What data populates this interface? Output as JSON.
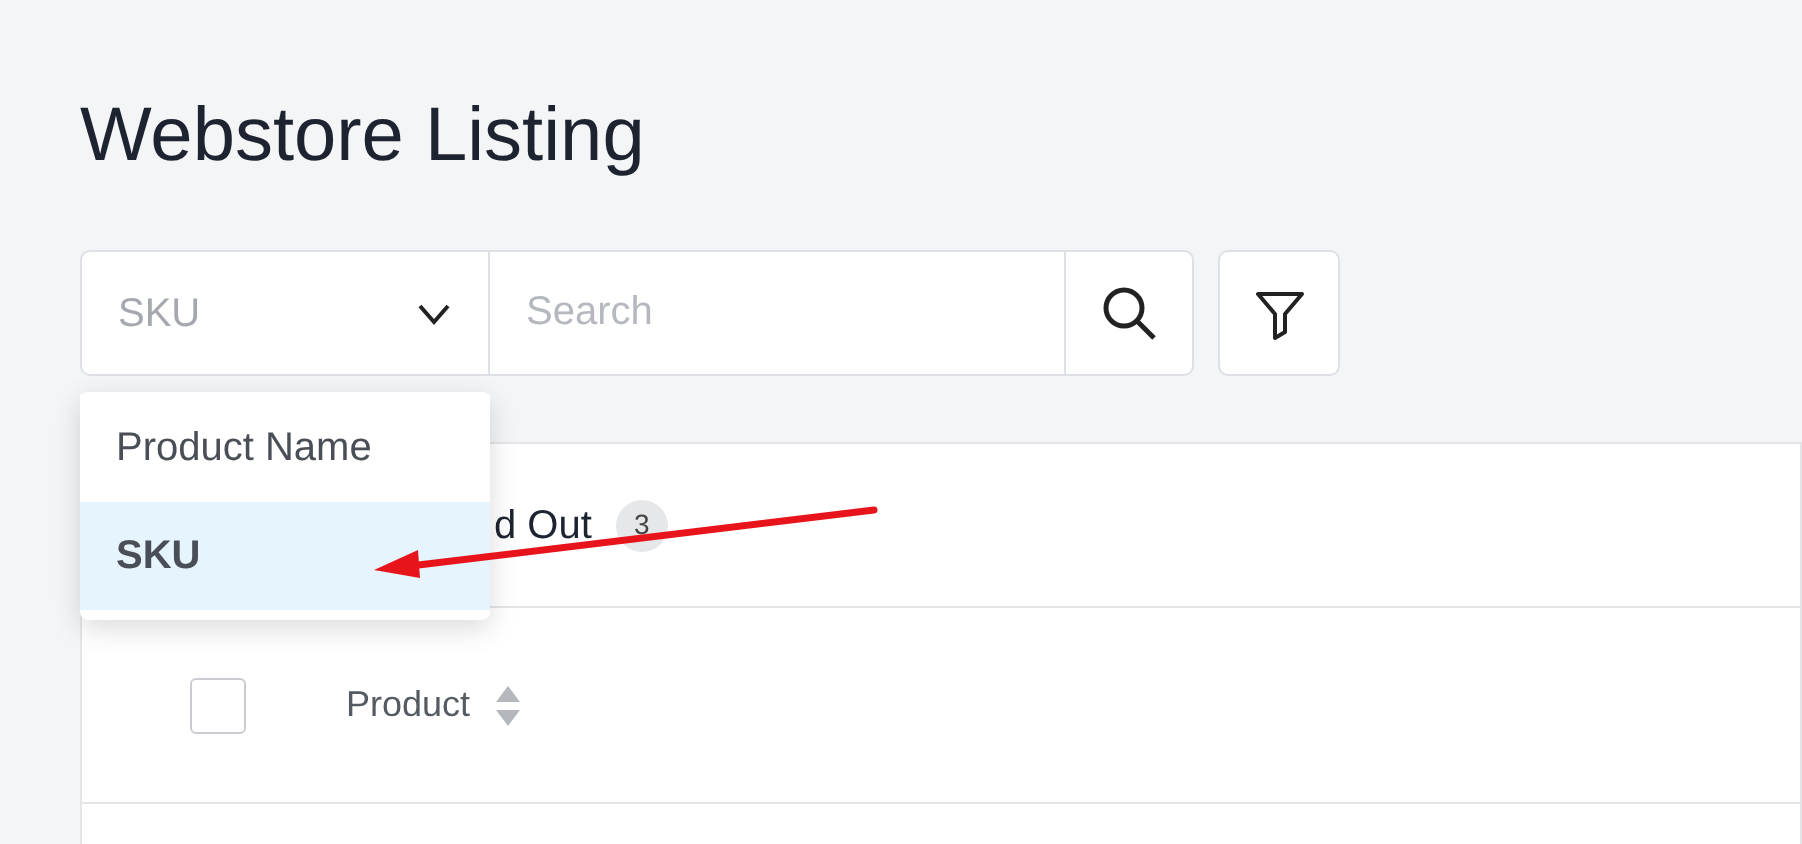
{
  "page_title": "Webstore Listing",
  "search": {
    "field_selector": "SKU",
    "placeholder": "Search"
  },
  "field_options": [
    {
      "label": "Product Name",
      "selected": false
    },
    {
      "label": "SKU",
      "selected": true
    }
  ],
  "tabs": [
    {
      "label": "d Out",
      "count": "3"
    }
  ],
  "table": {
    "columns": [
      {
        "label": "Product",
        "sortable": true
      }
    ],
    "select_all_checked": false
  }
}
